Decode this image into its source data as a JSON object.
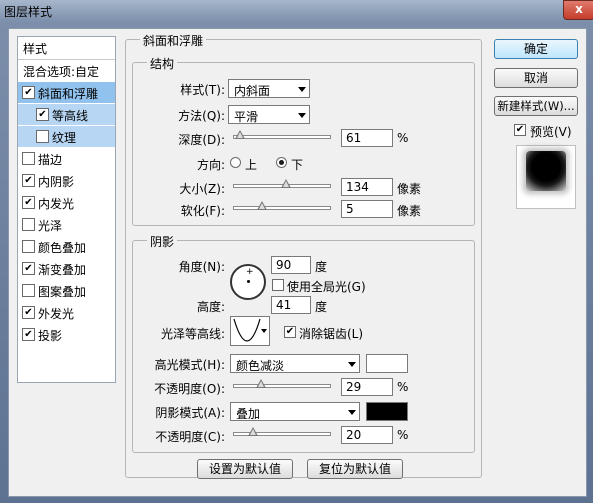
{
  "window": {
    "title": "图层样式",
    "close_glyph": "x"
  },
  "sidebar": {
    "header": "样式",
    "blend_options": "混合选项:自定",
    "items": [
      {
        "label": "斜面和浮雕",
        "checked": true,
        "selected": true,
        "sub": false
      },
      {
        "label": "等高线",
        "checked": true,
        "selected": false,
        "sub": true
      },
      {
        "label": "纹理",
        "checked": false,
        "selected": false,
        "sub": true
      },
      {
        "label": "描边",
        "checked": false,
        "selected": false,
        "sub": false
      },
      {
        "label": "内阴影",
        "checked": true,
        "selected": false,
        "sub": false
      },
      {
        "label": "内发光",
        "checked": true,
        "selected": false,
        "sub": false
      },
      {
        "label": "光泽",
        "checked": false,
        "selected": false,
        "sub": false
      },
      {
        "label": "颜色叠加",
        "checked": false,
        "selected": false,
        "sub": false
      },
      {
        "label": "渐变叠加",
        "checked": true,
        "selected": false,
        "sub": false
      },
      {
        "label": "图案叠加",
        "checked": false,
        "selected": false,
        "sub": false
      },
      {
        "label": "外发光",
        "checked": true,
        "selected": false,
        "sub": false
      },
      {
        "label": "投影",
        "checked": true,
        "selected": false,
        "sub": false
      }
    ]
  },
  "bevel": {
    "section_title": "斜面和浮雕",
    "structure": {
      "title": "结构",
      "style_label": "样式(T):",
      "style_value": "内斜面",
      "technique_label": "方法(Q):",
      "technique_value": "平滑",
      "depth_label": "深度(D):",
      "depth_value": "61",
      "depth_unit": "%",
      "depth_slider": 0.06,
      "direction_label": "方向:",
      "direction_up": "上",
      "direction_down": "下",
      "direction_selected": "down",
      "size_label": "大小(Z):",
      "size_value": "134",
      "size_unit": "像素",
      "size_slider": 0.55,
      "soften_label": "软化(F):",
      "soften_value": "5",
      "soften_unit": "像素",
      "soften_slider": 0.3
    },
    "shading": {
      "title": "阴影",
      "angle_label": "角度(N):",
      "angle_value": "90",
      "angle_unit": "度",
      "global_light_label": "使用全局光(G)",
      "global_light_checked": false,
      "altitude_label": "高度:",
      "altitude_value": "41",
      "altitude_unit": "度",
      "gloss_contour_label": "光泽等高线:",
      "anti_alias_label": "消除锯齿(L)",
      "anti_alias_checked": true,
      "highlight_mode_label": "高光模式(H):",
      "highlight_mode_value": "颜色减淡",
      "highlight_color": "#ffffff",
      "highlight_opacity_label": "不透明度(O):",
      "highlight_opacity_value": "29",
      "highlight_opacity_unit": "%",
      "highlight_opacity_slider": 0.29,
      "shadow_mode_label": "阴影模式(A):",
      "shadow_mode_value": "叠加",
      "shadow_color": "#000000",
      "shadow_opacity_label": "不透明度(C):",
      "shadow_opacity_value": "20",
      "shadow_opacity_unit": "%",
      "shadow_opacity_slider": 0.2
    },
    "make_default": "设置为默认值",
    "reset_default": "复位为默认值"
  },
  "buttons": {
    "ok": "确定",
    "cancel": "取消",
    "new_style": "新建样式(W)...",
    "preview_label": "预览(V)",
    "preview_checked": true
  }
}
